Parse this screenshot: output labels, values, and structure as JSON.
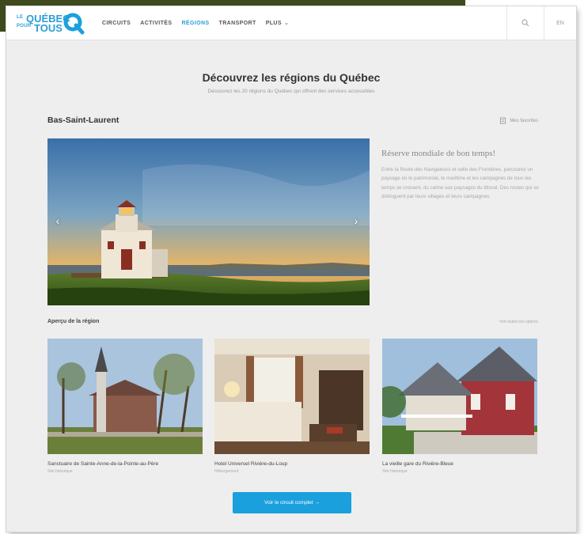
{
  "logo": {
    "line1": "LE",
    "line2": "POUR",
    "main1": "QUÉBEC",
    "main2": "TOUS"
  },
  "nav": {
    "items": [
      "CIRCUITS",
      "ACTIVITÉS",
      "RÉGIONS",
      "TRANSPORT"
    ],
    "active": "RÉGIONS",
    "more_label": "PLUS",
    "lang": "EN"
  },
  "page": {
    "title": "Découvrez les régions du Québec",
    "subtitle": "Découvrez les 20 régions du Québec qui offrent des services accessibles"
  },
  "region": {
    "name": "Bas-Saint-Laurent",
    "link": "Mes favorites",
    "feature_title": "Réserve mondiale de bon temps!",
    "feature_text": "Entre la Route des Navigateurs et celle des Frontières, parcourez un paysage où le patrimonial, le maritime et les campagnes de tous les temps se croisent, du calme aux paysages du littoral. Des routes qui se distinguent par leurs villages et leurs campagnes."
  },
  "apercu": {
    "title": "Aperçu de la région",
    "all_link": "Voir toutes les options"
  },
  "cards": [
    {
      "title": "Sanctuaire de Sainte-Anne-de-la-Pointe-au-Père",
      "subtitle": "Site historique"
    },
    {
      "title": "Hotel Universel Rivière-du-Loup",
      "subtitle": "Hébergement"
    },
    {
      "title": "La vieille gare du Rivière-Bleue",
      "subtitle": "Site historique"
    }
  ],
  "cta_label": "Voir le circuit complet →",
  "colors": {
    "accent": "#1aa0dc",
    "frame_bg": "#eeeeee",
    "deco": "#3e4a1e"
  }
}
